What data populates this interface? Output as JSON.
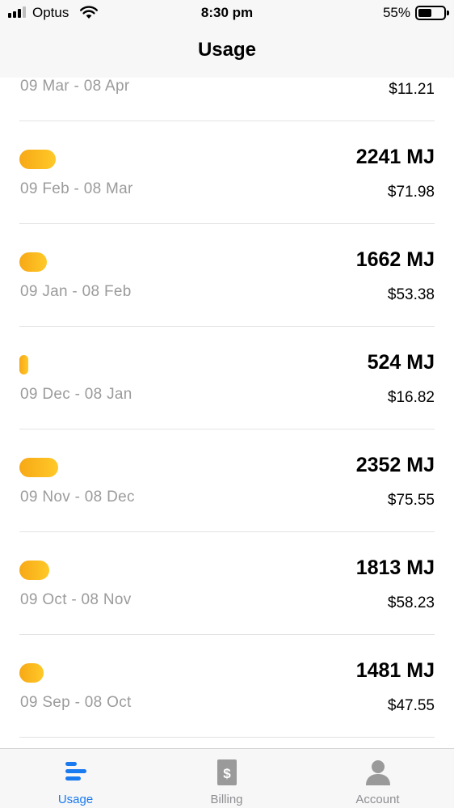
{
  "status_bar": {
    "carrier": "Optus",
    "time": "8:30 pm",
    "battery": "55%",
    "battery_level": 0.55,
    "signal_bars": 3,
    "signal_total": 4
  },
  "nav": {
    "title": "Usage"
  },
  "usage": {
    "bar_color": "#f8b21a",
    "rows": [
      {
        "period": "09 Mar - 08 Apr",
        "mj": "",
        "cost": "$11.21"
      },
      {
        "period": "09 Feb - 08 Mar",
        "mj": "2241 MJ",
        "cost": "$71.98",
        "value": 2241
      },
      {
        "period": "09 Jan - 08 Feb",
        "mj": "1662 MJ",
        "cost": "$53.38",
        "value": 1662
      },
      {
        "period": "09 Dec - 08 Jan",
        "mj": "524 MJ",
        "cost": "$16.82",
        "value": 524
      },
      {
        "period": "09 Nov - 08 Dec",
        "mj": "2352 MJ",
        "cost": "$75.55",
        "value": 2352
      },
      {
        "period": "09 Oct - 08 Nov",
        "mj": "1813 MJ",
        "cost": "$58.23",
        "value": 1813
      },
      {
        "period": "09 Sep - 08 Oct",
        "mj": "1481 MJ",
        "cost": "$47.55",
        "value": 1481
      }
    ]
  },
  "tabs": [
    {
      "label": "Usage",
      "icon": "usage-icon",
      "active": true
    },
    {
      "label": "Billing",
      "icon": "billing-icon",
      "active": false
    },
    {
      "label": "Account",
      "icon": "account-icon",
      "active": false
    }
  ],
  "colors": {
    "accent": "#1a7af0",
    "bar": "#f8b21a",
    "muted": "#9b9b9b"
  }
}
